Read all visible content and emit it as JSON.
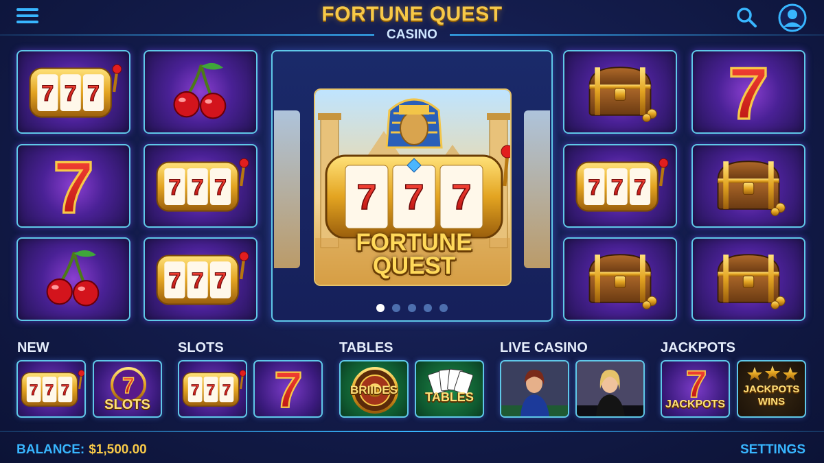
{
  "header": {
    "title": "FORTUNE QUEST",
    "subtitle": "CASINO",
    "menu_icon": "hamburger-menu-icon",
    "search_icon": "search-icon",
    "profile_icon": "user-profile-icon"
  },
  "grid_left": [
    {
      "icon": "slot-machine-777-icon"
    },
    {
      "icon": "cherry-icon"
    },
    {
      "icon": "lucky-seven-icon"
    },
    {
      "icon": "slot-machine-777-icon"
    },
    {
      "icon": "cherry-icon"
    },
    {
      "icon": "slot-machine-777-icon"
    }
  ],
  "grid_right": [
    {
      "icon": "treasure-chest-icon"
    },
    {
      "icon": "lucky-seven-icon"
    },
    {
      "icon": "slot-machine-777-icon"
    },
    {
      "icon": "treasure-chest-icon"
    },
    {
      "icon": "treasure-chest-icon"
    },
    {
      "icon": "treasure-chest-icon"
    }
  ],
  "featured": {
    "name_line1": "FORTUNE",
    "name_line2": "QUEST",
    "reel_symbols": [
      "7",
      "7",
      "7"
    ],
    "carousel_pages": 5,
    "active_page": 1
  },
  "categories": [
    {
      "label": "NEW",
      "tiles": [
        {
          "icon": "slot-machine-777-icon",
          "text": ""
        },
        {
          "icon": "slots-badge-icon",
          "text": "SLOTS"
        }
      ]
    },
    {
      "label": "SLOTS",
      "tiles": [
        {
          "icon": "slot-machine-777-icon",
          "text": ""
        },
        {
          "icon": "lucky-seven-icon",
          "text": ""
        }
      ]
    },
    {
      "label": "TABLES",
      "tiles": [
        {
          "icon": "roulette-wheel-icon",
          "text": "BRIIDES"
        },
        {
          "icon": "playing-cards-icon",
          "text": "TABLES"
        }
      ]
    },
    {
      "label": "LIVE CASINO",
      "tiles": [
        {
          "icon": "live-dealer-icon",
          "text": ""
        },
        {
          "icon": "live-dealer-icon",
          "text": ""
        }
      ]
    },
    {
      "label": "JACKPOTS",
      "tiles": [
        {
          "icon": "jackpot-seven-icon",
          "text": "JACKPOTS"
        },
        {
          "icon": "jackpot-stars-icon",
          "text": "JACKPOTS WINS"
        }
      ]
    }
  ],
  "footer": {
    "balance_label": "BALANCE:",
    "balance_value": "$1,500.00",
    "settings_label": "SETTINGS"
  },
  "colors": {
    "accent_blue": "#38b6ff",
    "gold": "#f7c948",
    "tile_border": "#5fc8e8"
  }
}
